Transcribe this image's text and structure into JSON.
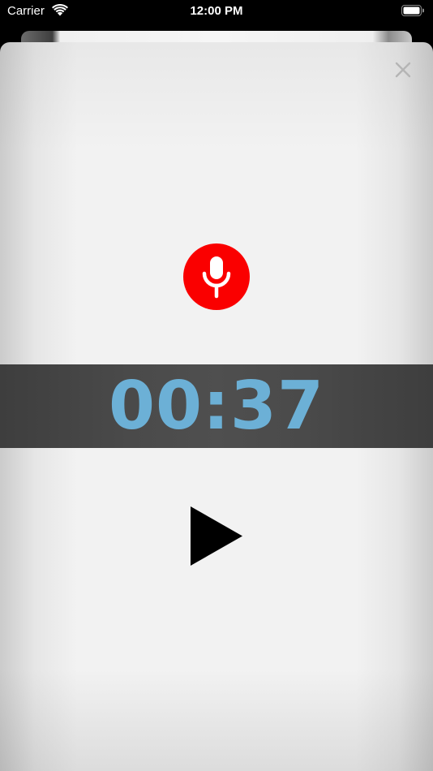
{
  "status_bar": {
    "carrier": "Carrier",
    "time": "12:00 PM",
    "icons": [
      "wifi-icon",
      "battery-icon"
    ]
  },
  "sheet": {
    "close_icon": "close-icon",
    "record_icon": "microphone-icon",
    "timer": "00:37",
    "play_icon": "play-icon"
  },
  "colors": {
    "record_button": "#fa0000",
    "timer_text": "#6cb0d6",
    "timer_band": "#4a4a4a",
    "sheet_background": "#f2f2f2"
  }
}
